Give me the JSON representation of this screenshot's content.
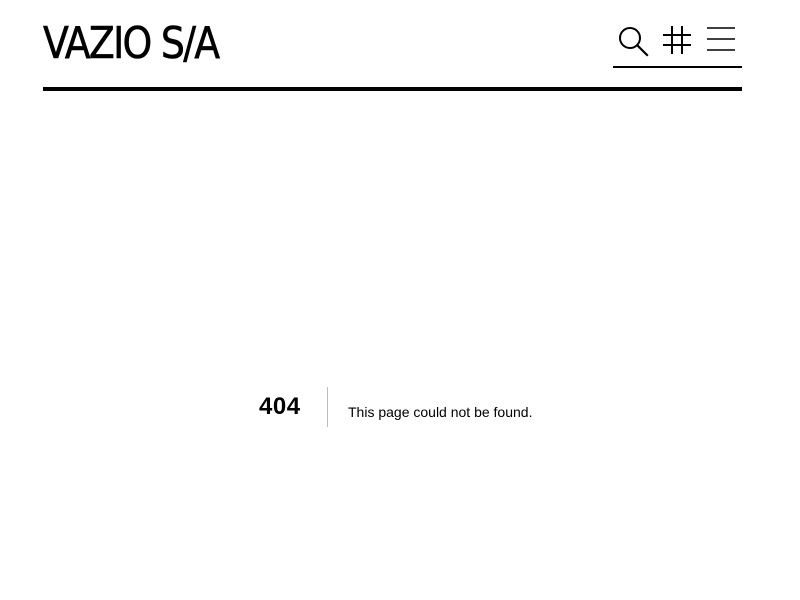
{
  "header": {
    "logo_text": "VAZIO S/A",
    "icons": [
      {
        "name": "search-icon"
      },
      {
        "name": "hashtag-icon"
      },
      {
        "name": "menu-icon"
      }
    ]
  },
  "error": {
    "code": "404",
    "message": "This page could not be found."
  },
  "colors": {
    "text": "#000000",
    "background": "#ffffff",
    "divider": "#bdbdbd"
  }
}
